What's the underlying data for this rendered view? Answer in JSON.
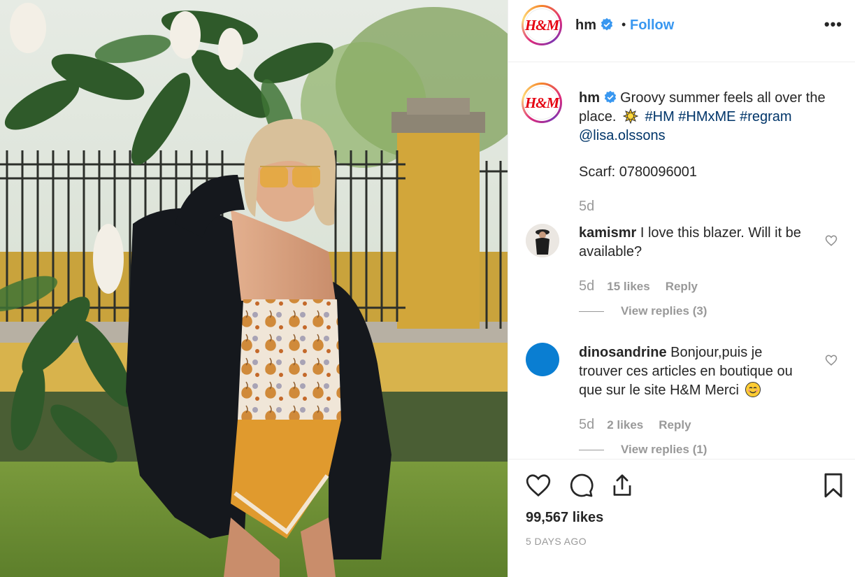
{
  "post": {
    "image_alt": "Woman in yellow sunglasses wearing a paisley scarf top and black blazer in a garden",
    "username": "hm",
    "avatar_text": "H&M",
    "follow_label": "Follow",
    "separator": "•",
    "more_label": "•••"
  },
  "caption": {
    "username": "hm",
    "text": "Groovy summer feels all over the place.",
    "emoji": "sun-emoji",
    "hashtags": [
      "#HM",
      "#HMxME",
      "#regram"
    ],
    "mention": "@lisa.olssons",
    "scarf_line": "Scarf: 0780096001",
    "time": "5d"
  },
  "comments": [
    {
      "username": "kamismr",
      "text": "I love this blazer. Will it be available?",
      "time": "5d",
      "likes": "15 likes",
      "reply_label": "Reply",
      "view_replies": "View replies (3)"
    },
    {
      "username": "dinosandrine",
      "text": "Bonjour,puis je trouver ces articles en boutique ou que sur le site H&M Merci",
      "time": "5d",
      "likes": "2 likes",
      "reply_label": "Reply",
      "view_replies": "View replies (1)"
    }
  ],
  "footer": {
    "likes": "99,567 likes",
    "date": "5 DAYS AGO",
    "icons": [
      "heart-icon",
      "comment-icon",
      "share-icon",
      "bookmark-icon"
    ]
  },
  "colors": {
    "link": "#3897f0",
    "hashtag": "#003569",
    "muted": "#999999",
    "brand_red": "#e50010"
  }
}
